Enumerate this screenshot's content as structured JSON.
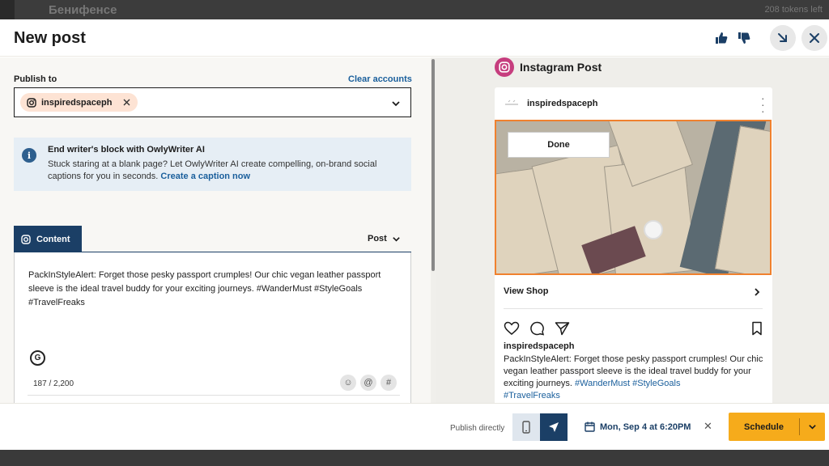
{
  "background": {
    "title": "Бенифенсе",
    "right_text": "208 tokens left"
  },
  "header": {
    "title": "New post"
  },
  "publish_to": {
    "label": "Publish to",
    "clear_label": "Clear accounts",
    "account": "inspiredspaceph"
  },
  "ai_banner": {
    "title": "End writer's block with OwlyWriter AI",
    "body": "Stuck staring at a blank page? Let OwlyWriter AI create compelling, on-brand social captions for you in seconds.",
    "link": "Create a caption now"
  },
  "composer": {
    "tab_label": "Content",
    "post_type": "Post",
    "text": "PackInStyleAlert: Forget those pesky passport crumples! Our chic vegan leather passport sleeve is the ideal travel buddy for your exciting journeys. #WanderMust #StyleGoals #TravelFreaks",
    "char_count": "187 / 2,200",
    "g_label": "G",
    "emoji_glyph": "☺",
    "mention_glyph": "@",
    "hashtag_glyph": "#",
    "remove_glyph": "✕"
  },
  "preview": {
    "title": "Instagram Post",
    "username": "inspiredspaceph",
    "done_label": "Done",
    "view_shop": "View Shop",
    "caption_user": "inspiredspaceph",
    "caption_text": "PackInStyleAlert: Forget those pesky passport crumples! Our chic vegan leather passport sleeve is the ideal travel buddy for your exciting journeys. ",
    "caption_tags_inline": "#WanderMust #StyleGoals",
    "caption_tags_last": "#TravelFreaks"
  },
  "footer": {
    "publish_directly": "Publish directly",
    "date": "Mon, Sep 4 at 6:20PM",
    "clear_glyph": "✕",
    "schedule_label": "Schedule"
  },
  "colors": {
    "navy": "#1b3f66",
    "schedule": "#f6ab1b",
    "link": "#1a5f9c",
    "instagram": "#c63d7e",
    "chip": "#fde3d4",
    "image_outline": "#f0812e"
  }
}
